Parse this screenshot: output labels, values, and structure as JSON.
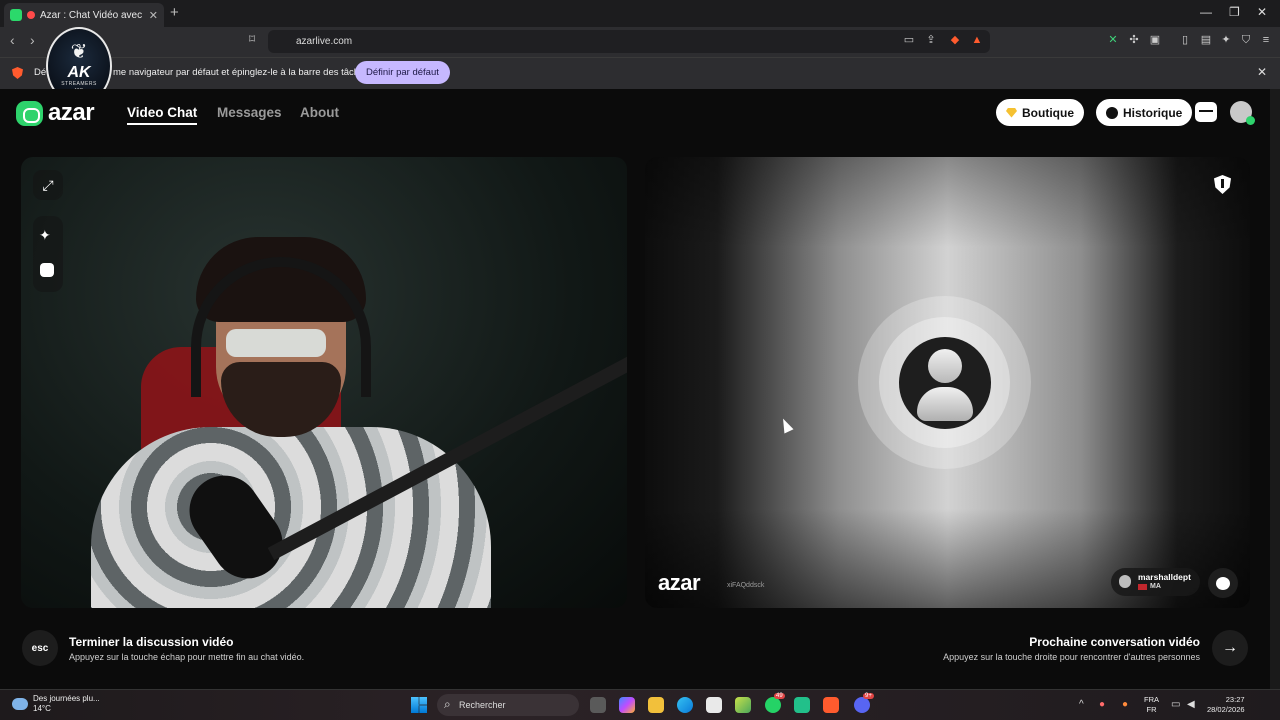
{
  "browser": {
    "tab_title": "Azar : Chat Vidéo avec de no",
    "url": "azarlive.com",
    "infobar_text": "Dé",
    "infobar_text2": "me navigateur par défaut et épinglez-le à la barre des tâches",
    "set_default_label": "Définir par défaut"
  },
  "overlay_logo": {
    "text": "AK",
    "subtext": "STREAMERS",
    "subtext2": "rap"
  },
  "azar": {
    "logo_text": "azar",
    "nav": [
      "Video Chat",
      "Messages",
      "About"
    ],
    "boutique_label": "Boutique",
    "historique_label": "Historique"
  },
  "remote": {
    "watermark": "azar",
    "session_id": "xiFAQddsck",
    "username": "marshalldept",
    "country": "MA"
  },
  "controls": {
    "esc_label": "esc",
    "end_title": "Terminer la discussion vidéo",
    "end_sub": "Appuyez sur la touche échap pour mettre fin au chat vidéo.",
    "next_title": "Prochaine conversation vidéo",
    "next_sub": "Appuyez sur la touche droite pour rencontrer d'autres personnes"
  },
  "taskbar": {
    "weather_text": "Des journées plu...",
    "temperature": "14°C",
    "search_placeholder": "Rechercher",
    "lang_top": "FRA",
    "lang_bottom": "FR",
    "time": "23:27",
    "date": "28/02/2026",
    "badge_whatsapp": "49",
    "badge_discord": "9+"
  },
  "colors": {
    "azar_green": "#2ed36c",
    "set_default_bg": "#c6b8ff",
    "gem": "#f5c131"
  }
}
